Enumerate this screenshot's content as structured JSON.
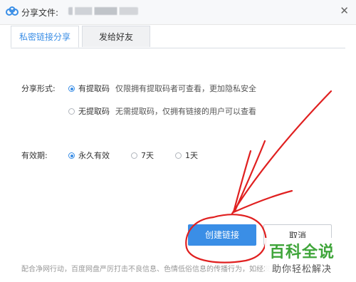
{
  "titlebar": {
    "title_label": "分享文件:",
    "app_icon": "baidu-netdisk-cloud-icon"
  },
  "tabs": [
    {
      "label": "私密链接分享",
      "active": true
    },
    {
      "label": "发给好友",
      "active": false
    }
  ],
  "share_form": {
    "label": "分享形式:",
    "options": [
      {
        "label": "有提取码",
        "hint": "仅限拥有提取码者可查看，更加隐私安全",
        "checked": true
      },
      {
        "label": "无提取码",
        "hint": "无需提取码，仅拥有链接的用户可以查看",
        "checked": false
      }
    ]
  },
  "validity": {
    "label": "有效期:",
    "options": [
      {
        "label": "永久有效",
        "checked": true
      },
      {
        "label": "7天",
        "checked": false
      },
      {
        "label": "1天",
        "checked": false
      }
    ]
  },
  "buttons": {
    "create": "创建链接",
    "cancel": "取消"
  },
  "footer": "配合净网行动，百度网盘严厉打击不良信息、色情低俗信息的传播行为，如经发现",
  "watermark": {
    "title": "百科全说",
    "subtitle": "助你轻松解决"
  },
  "colors": {
    "accent": "#3a8ee6",
    "annotation": "#e02020",
    "watermark": "#3fa53a"
  }
}
